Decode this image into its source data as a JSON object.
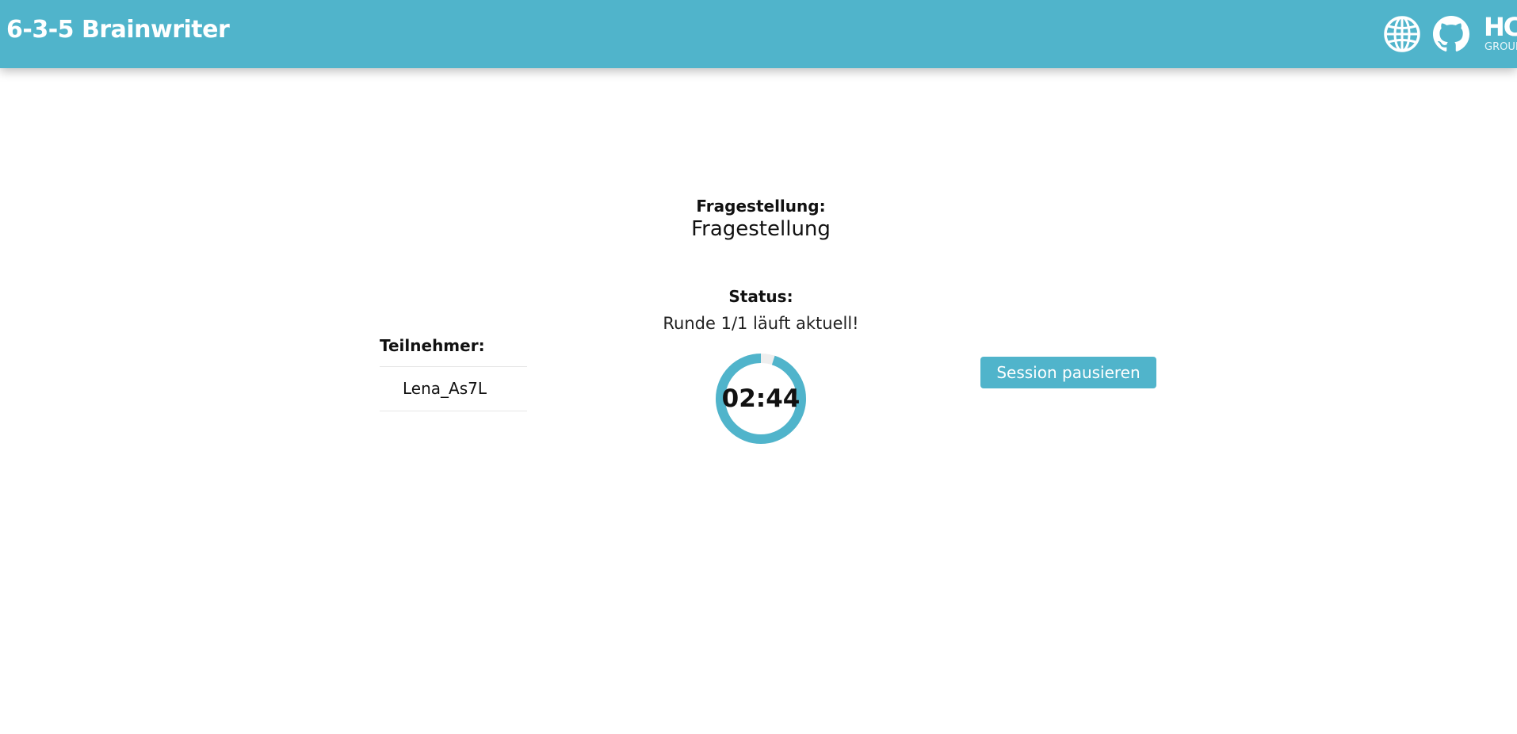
{
  "app": {
    "title": "6-3-5 Brainwriter"
  },
  "header": {
    "icons": [
      "globe-icon",
      "github-icon",
      "hci-group-logo"
    ],
    "logo": {
      "main": "HCI",
      "sub": "GROUP"
    }
  },
  "question": {
    "heading": "Fragestellung:",
    "text": "Fragestellung"
  },
  "status": {
    "heading": "Status:",
    "text": "Runde 1/1 läuft aktuell!"
  },
  "participants": {
    "heading": "Teilnehmer:",
    "items": [
      "Lena_As7L"
    ]
  },
  "timer": {
    "display": "02:44",
    "progress": 0.95
  },
  "actions": {
    "pause_label": "Session pausieren"
  },
  "colors": {
    "accent": "#50b4cb",
    "track": "#eeeeee"
  }
}
